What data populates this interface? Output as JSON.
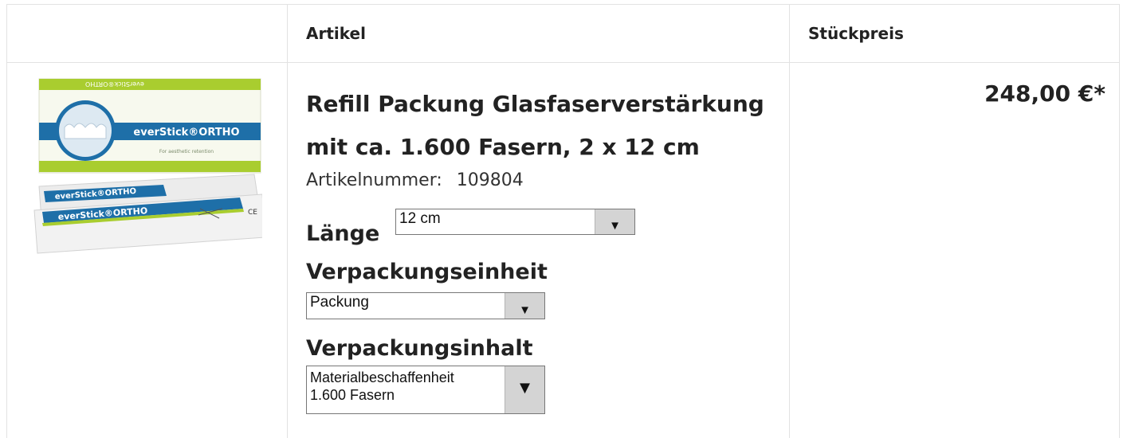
{
  "table": {
    "headers": {
      "image": "",
      "article": "Artikel",
      "unit_price": "Stückpreis"
    }
  },
  "product": {
    "image": {
      "box_brand_small": "everStick®ORTHO",
      "box_brand": "everStick®ORTHO",
      "box_tagline": "For aesthetic retention",
      "sachet_brand": "everStick®ORTHO",
      "ce_mark": "CE"
    },
    "title_line1": "Refill Packung Glasfaserverstärkung",
    "title_line2": "mit ca. 1.600 Fasern, 2 x 12 cm",
    "article_number_label": "Artikelnummer:",
    "article_number": "109804",
    "options": {
      "length_label": "Länge",
      "length_value": "12 cm",
      "packaging_unit_label": "Verpackungseinheit",
      "packaging_unit_value": "Packung",
      "packaging_content_label": "Verpackungsinhalt",
      "packaging_content_value": "Materialbeschaffenheit\n1.600 Fasern"
    },
    "price": "248,00 €*"
  },
  "icons": {
    "dropdown_arrow": "▼"
  },
  "colors": {
    "box_green": "#a9cd2f",
    "box_blue": "#1e6fa8",
    "border": "#e2e2e2",
    "select_button": "#d4d4d4"
  }
}
